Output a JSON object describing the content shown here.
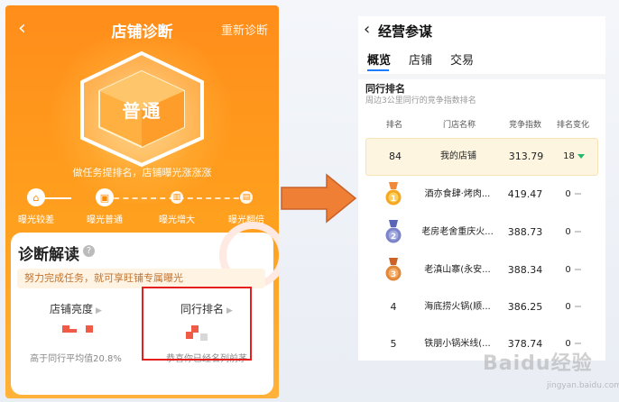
{
  "left_screen": {
    "title": "店铺诊断",
    "back_icon": "chevron-left-icon",
    "rediagnose_label": "重新诊断",
    "level_badge": "普通",
    "tip": "做任务提排名，店铺曝光涨涨涨",
    "steps": [
      {
        "label": "曝光较差",
        "icon": "home-icon"
      },
      {
        "label": "曝光普通",
        "icon": "storefront-icon"
      },
      {
        "label": "曝光增大",
        "icon": "building-icon"
      },
      {
        "label": "曝光翻倍",
        "icon": "skyscraper-icon"
      }
    ],
    "current_step": 1,
    "card": {
      "title": "诊断解读",
      "help_icon": "question-icon",
      "notice": "努力完成任务，就可享旺铺专属曝光",
      "metrics": [
        {
          "label": "店铺亮度",
          "subtext": "高于同行平均值20.8%"
        },
        {
          "label": "同行排名",
          "subtext": "恭喜你已经名列前茅"
        }
      ]
    }
  },
  "right_screen": {
    "title": "经营参谋",
    "back_icon": "chevron-left-icon",
    "tabs": [
      {
        "label": "概览"
      },
      {
        "label": "店铺"
      },
      {
        "label": "交易"
      }
    ],
    "active_tab": 0,
    "section_title": "同行排名",
    "section_subtitle": "周边3公里同行的竞争指数排名",
    "columns": [
      "排名",
      "门店名称",
      "竞争指数",
      "排名变化"
    ],
    "rows": [
      {
        "rank": "84",
        "name": "我的店铺",
        "index": "313.79",
        "change": "18",
        "trend": "down",
        "highlight": true
      },
      {
        "rank": "1",
        "name": "酒亦食肆·烤肉...",
        "index": "419.47",
        "change": "0",
        "trend": "flat",
        "medal": "gold"
      },
      {
        "rank": "2",
        "name": "老房老舍重庆火...",
        "index": "388.73",
        "change": "0",
        "trend": "flat",
        "medal": "silver"
      },
      {
        "rank": "3",
        "name": "老滇山寨(永安...",
        "index": "388.34",
        "change": "0",
        "trend": "flat",
        "medal": "bronze"
      },
      {
        "rank": "4",
        "name": "海底捞火锅(顺...",
        "index": "386.25",
        "change": "0",
        "trend": "flat"
      },
      {
        "rank": "5",
        "name": "铁朋小锅米线(...",
        "index": "378.74",
        "change": "0",
        "trend": "flat"
      }
    ]
  },
  "colors": {
    "orange": "#ff8d1a",
    "notice_bg": "#fff3e3",
    "highlight_box": "#e51e1e",
    "tab_underline": "#1e7cff",
    "trend_down": "#23b86b",
    "gold": "#f5a623",
    "silver": "#7b83c9",
    "bronze": "#e0893a"
  },
  "watermark": {
    "text": "Baidu经验",
    "sub": "jingyan.baidu.com"
  }
}
